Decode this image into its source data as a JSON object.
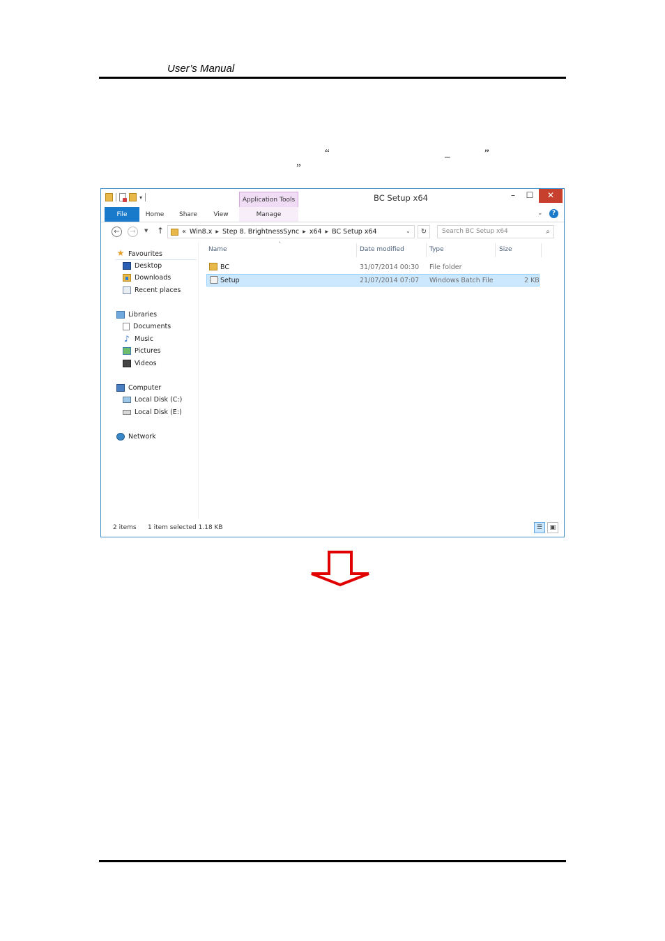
{
  "page": {
    "header_title": "User’s Manual",
    "fragments": [
      "“",
      "_",
      "”",
      "”"
    ]
  },
  "window": {
    "title": "BC Setup x64",
    "app_tools_label": "Application Tools",
    "ribbon_tabs": [
      "File",
      "Home",
      "Share",
      "View",
      "Manage"
    ],
    "buttons": {
      "minimize": "–",
      "maximize": "☐",
      "close": "✕"
    },
    "help": "?"
  },
  "address": {
    "overflow": "«",
    "crumbs": [
      "Win8.x",
      "Step 8. BrightnessSync",
      "x64",
      "BC Setup x64"
    ],
    "search_placeholder": "Search BC Setup x64"
  },
  "nav": {
    "favourites": {
      "label": "Favourites",
      "items": [
        "Desktop",
        "Downloads",
        "Recent places"
      ]
    },
    "libraries": {
      "label": "Libraries",
      "items": [
        "Documents",
        "Music",
        "Pictures",
        "Videos"
      ]
    },
    "computer": {
      "label": "Computer",
      "items": [
        "Local Disk (C:)",
        "Local Disk (E:)"
      ]
    },
    "network": {
      "label": "Network"
    }
  },
  "columns": {
    "name": "Name",
    "date": "Date modified",
    "type": "Type",
    "size": "Size"
  },
  "files": [
    {
      "name": "BC",
      "date": "31/07/2014 00:30",
      "type": "File folder",
      "size": "",
      "icon": "folder-icon",
      "selected": false
    },
    {
      "name": "Setup",
      "date": "21/07/2014 07:07",
      "type": "Windows Batch File",
      "size": "2 KB",
      "icon": "batch-file-icon",
      "selected": true
    }
  ],
  "status": {
    "count": "2 items",
    "selection": "1 item selected  1.18 KB"
  },
  "colors": {
    "accent": "#1979ca",
    "close": "#c7402d",
    "arrow": "#e00000",
    "selection": "#cce8ff"
  }
}
